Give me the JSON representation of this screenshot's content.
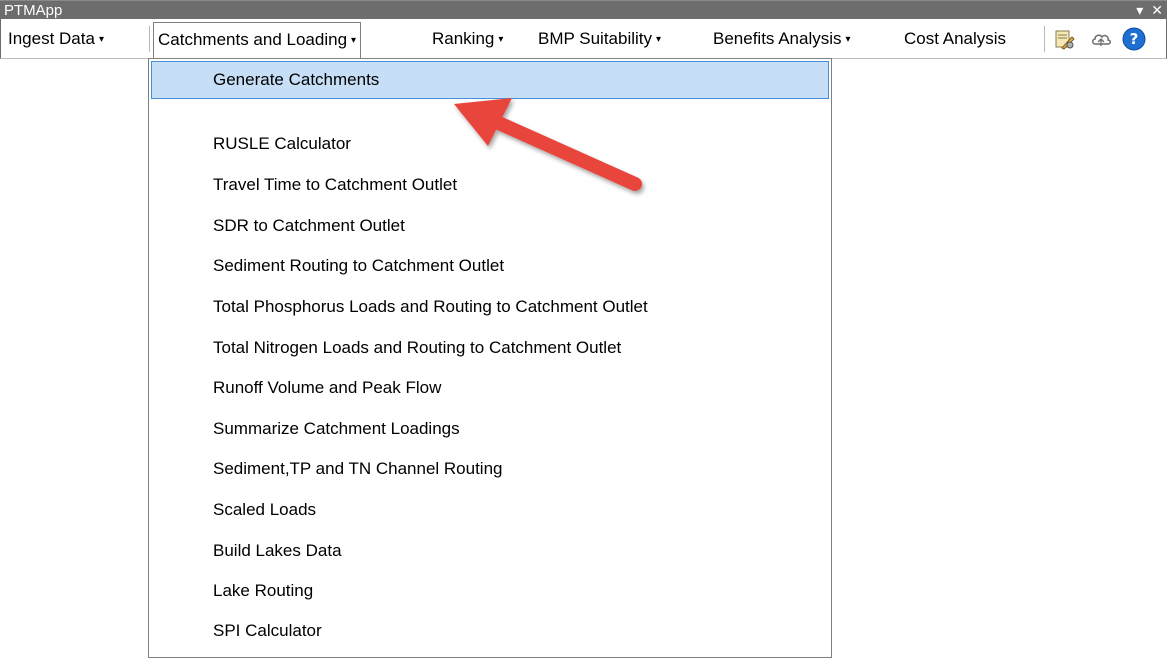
{
  "window": {
    "title": "PTMApp",
    "controls": {
      "dropdown": "▾",
      "close": "✕"
    }
  },
  "toolbar": {
    "menus": [
      {
        "label": "Ingest Data",
        "caret": "▾"
      },
      {
        "label": "Catchments and Loading",
        "caret": "▾",
        "open": true
      },
      {
        "label": "Ranking",
        "caret": "▾"
      },
      {
        "label": "BMP Suitability",
        "caret": "▾"
      },
      {
        "label": "Benefits Analysis",
        "caret": "▾"
      },
      {
        "label": "Cost Analysis"
      }
    ],
    "icons": [
      "tools-icon",
      "cloud-icon",
      "help-icon"
    ],
    "help_glyph": "?"
  },
  "dropdown": {
    "items": [
      "Generate Catchments",
      "RUSLE Calculator",
      "Travel Time to Catchment Outlet",
      "SDR to Catchment Outlet",
      "Sediment Routing to Catchment Outlet",
      "Total Phosphorus Loads and Routing to Catchment Outlet",
      "Total Nitrogen Loads and Routing to Catchment Outlet",
      "Runoff Volume and Peak Flow",
      "Summarize Catchment Loadings",
      "Sediment,TP and TN Channel Routing",
      "Scaled Loads",
      "Build Lakes Data",
      "Lake Routing",
      "SPI Calculator"
    ],
    "selected_index": 0
  },
  "colors": {
    "titlebar": "#6d6d6d",
    "menu_highlight": "#c6dff6",
    "menu_highlight_border": "#4a8fd6",
    "annotation_arrow": "#e8453c",
    "help_icon": "#1f6fd1"
  }
}
